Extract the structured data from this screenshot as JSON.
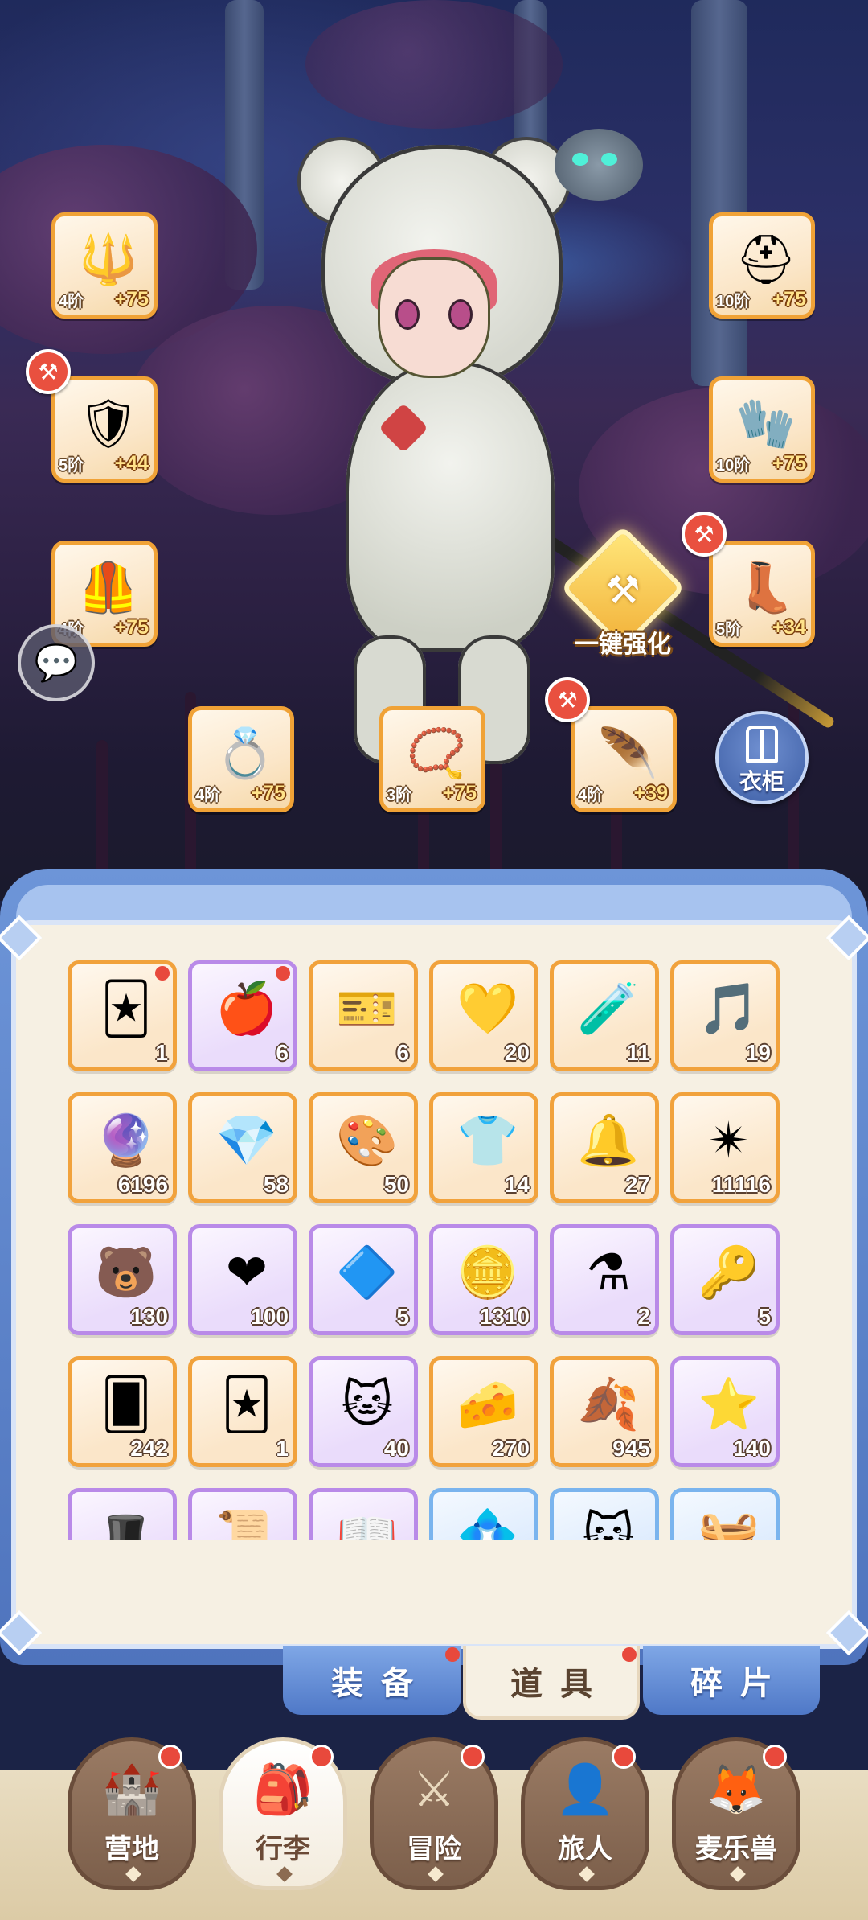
{
  "equipment": {
    "weapon": {
      "icon": "halberd-icon",
      "tier": "4阶",
      "plus": "+75"
    },
    "armor": {
      "icon": "chest-armor-icon",
      "tier": "5阶",
      "plus": "+44"
    },
    "greaves": {
      "icon": "greaves-icon",
      "tier": "4阶",
      "plus": "+75"
    },
    "helmet": {
      "icon": "helmet-icon",
      "tier": "10阶",
      "plus": "+75"
    },
    "bracer": {
      "icon": "bracer-icon",
      "tier": "10阶",
      "plus": "+75"
    },
    "boots": {
      "icon": "boots-icon",
      "tier": "5阶",
      "plus": "+34"
    },
    "ring": {
      "icon": "ring-icon",
      "tier": "4阶",
      "plus": "+75"
    },
    "necklace": {
      "icon": "necklace-icon",
      "tier": "3阶",
      "plus": "+75"
    },
    "earring": {
      "icon": "earring-icon",
      "tier": "4阶",
      "plus": "+39"
    }
  },
  "buttons": {
    "enhance_all": "一键强化",
    "wardrobe": "衣柜"
  },
  "inventory": [
    {
      "icon": "eye-card-icon",
      "glyph": "🃏",
      "count": "1",
      "rarity": "orange",
      "new": true
    },
    {
      "icon": "apple-icon",
      "glyph": "🍎",
      "count": "6",
      "rarity": "purple",
      "new": true
    },
    {
      "icon": "ticket-icon",
      "glyph": "🎫",
      "count": "6",
      "rarity": "orange",
      "new": false
    },
    {
      "icon": "yellow-crystal-icon",
      "glyph": "💛",
      "count": "20",
      "rarity": "orange",
      "new": false
    },
    {
      "icon": "blue-potion-icon",
      "glyph": "🧪",
      "count": "11",
      "rarity": "orange",
      "new": false
    },
    {
      "icon": "lyre-icon",
      "glyph": "🎵",
      "count": "19",
      "rarity": "orange",
      "new": false
    },
    {
      "icon": "portal-orb-icon",
      "glyph": "🔮",
      "count": "6196",
      "rarity": "orange",
      "new": false
    },
    {
      "icon": "ice-crystal-icon",
      "glyph": "💎",
      "count": "58",
      "rarity": "orange",
      "new": false
    },
    {
      "icon": "paint-tube-icon",
      "glyph": "🎨",
      "count": "50",
      "rarity": "orange",
      "new": false
    },
    {
      "icon": "outfit-card-icon",
      "glyph": "👕",
      "count": "14",
      "rarity": "orange",
      "new": false
    },
    {
      "icon": "bell-icon",
      "glyph": "🔔",
      "count": "27",
      "rarity": "orange",
      "new": false
    },
    {
      "icon": "star-crystal-icon",
      "glyph": "✴",
      "count": "11116",
      "rarity": "orange",
      "new": false
    },
    {
      "icon": "bear-badge-icon",
      "glyph": "🐻",
      "count": "130",
      "rarity": "purple",
      "new": false
    },
    {
      "icon": "heart-icon",
      "glyph": "❤",
      "count": "100",
      "rarity": "purple",
      "new": false
    },
    {
      "icon": "purple-gem-icon",
      "glyph": "🔷",
      "count": "5",
      "rarity": "purple",
      "new": false
    },
    {
      "icon": "heart-coin-icon",
      "glyph": "🪙",
      "count": "1310",
      "rarity": "purple",
      "new": false
    },
    {
      "icon": "red-potion-icon",
      "glyph": "⚗",
      "count": "2",
      "rarity": "purple",
      "new": false
    },
    {
      "icon": "key-icon",
      "glyph": "🔑",
      "count": "5",
      "rarity": "purple",
      "new": false
    },
    {
      "icon": "blue-card-icon",
      "glyph": "🂠",
      "count": "242",
      "rarity": "orange",
      "new": false
    },
    {
      "icon": "gold-card-icon",
      "glyph": "🃏",
      "count": "1",
      "rarity": "orange",
      "new": false
    },
    {
      "icon": "cat-orb-icon",
      "glyph": "🐱",
      "count": "40",
      "rarity": "purple",
      "new": false
    },
    {
      "icon": "cheese-icon",
      "glyph": "🧀",
      "count": "270",
      "rarity": "orange",
      "new": false
    },
    {
      "icon": "gold-leaf-icon",
      "glyph": "🍂",
      "count": "945",
      "rarity": "orange",
      "new": false
    },
    {
      "icon": "star-cookie-icon",
      "glyph": "⭐",
      "count": "140",
      "rarity": "purple",
      "new": false
    },
    {
      "icon": "blue-hat-icon",
      "glyph": "🎩",
      "count": "",
      "rarity": "purple",
      "new": false
    },
    {
      "icon": "scroll-icon",
      "glyph": "📜",
      "count": "",
      "rarity": "purple",
      "new": false
    },
    {
      "icon": "book-icon",
      "glyph": "📖",
      "count": "",
      "rarity": "purple",
      "new": false
    },
    {
      "icon": "crystal-icon",
      "glyph": "💠",
      "count": "",
      "rarity": "blue",
      "new": false
    },
    {
      "icon": "cat-item-icon",
      "glyph": "🐱",
      "count": "",
      "rarity": "blue",
      "new": false
    },
    {
      "icon": "basket-icon",
      "glyph": "🧺",
      "count": "",
      "rarity": "blue",
      "new": false
    }
  ],
  "tabs": [
    {
      "label": "装备",
      "active": false,
      "badge": true
    },
    {
      "label": "道具",
      "active": true,
      "badge": true
    },
    {
      "label": "碎片",
      "active": false,
      "badge": false
    }
  ],
  "nav": [
    {
      "label": "营地",
      "icon": "castle-icon",
      "active": false,
      "badge": true
    },
    {
      "label": "行李",
      "icon": "backpack-icon",
      "active": true,
      "badge": true
    },
    {
      "label": "冒险",
      "icon": "crossed-swords-icon",
      "active": false,
      "badge": true
    },
    {
      "label": "旅人",
      "icon": "traveler-icon",
      "active": false,
      "badge": true
    },
    {
      "label": "麦乐兽",
      "icon": "fox-pet-icon",
      "active": false,
      "badge": true
    }
  ],
  "colors": {
    "badge": "#e8493c",
    "slot_border": "#f0a236",
    "panel": "#f6f0e3",
    "frame": "#4f74bd"
  }
}
